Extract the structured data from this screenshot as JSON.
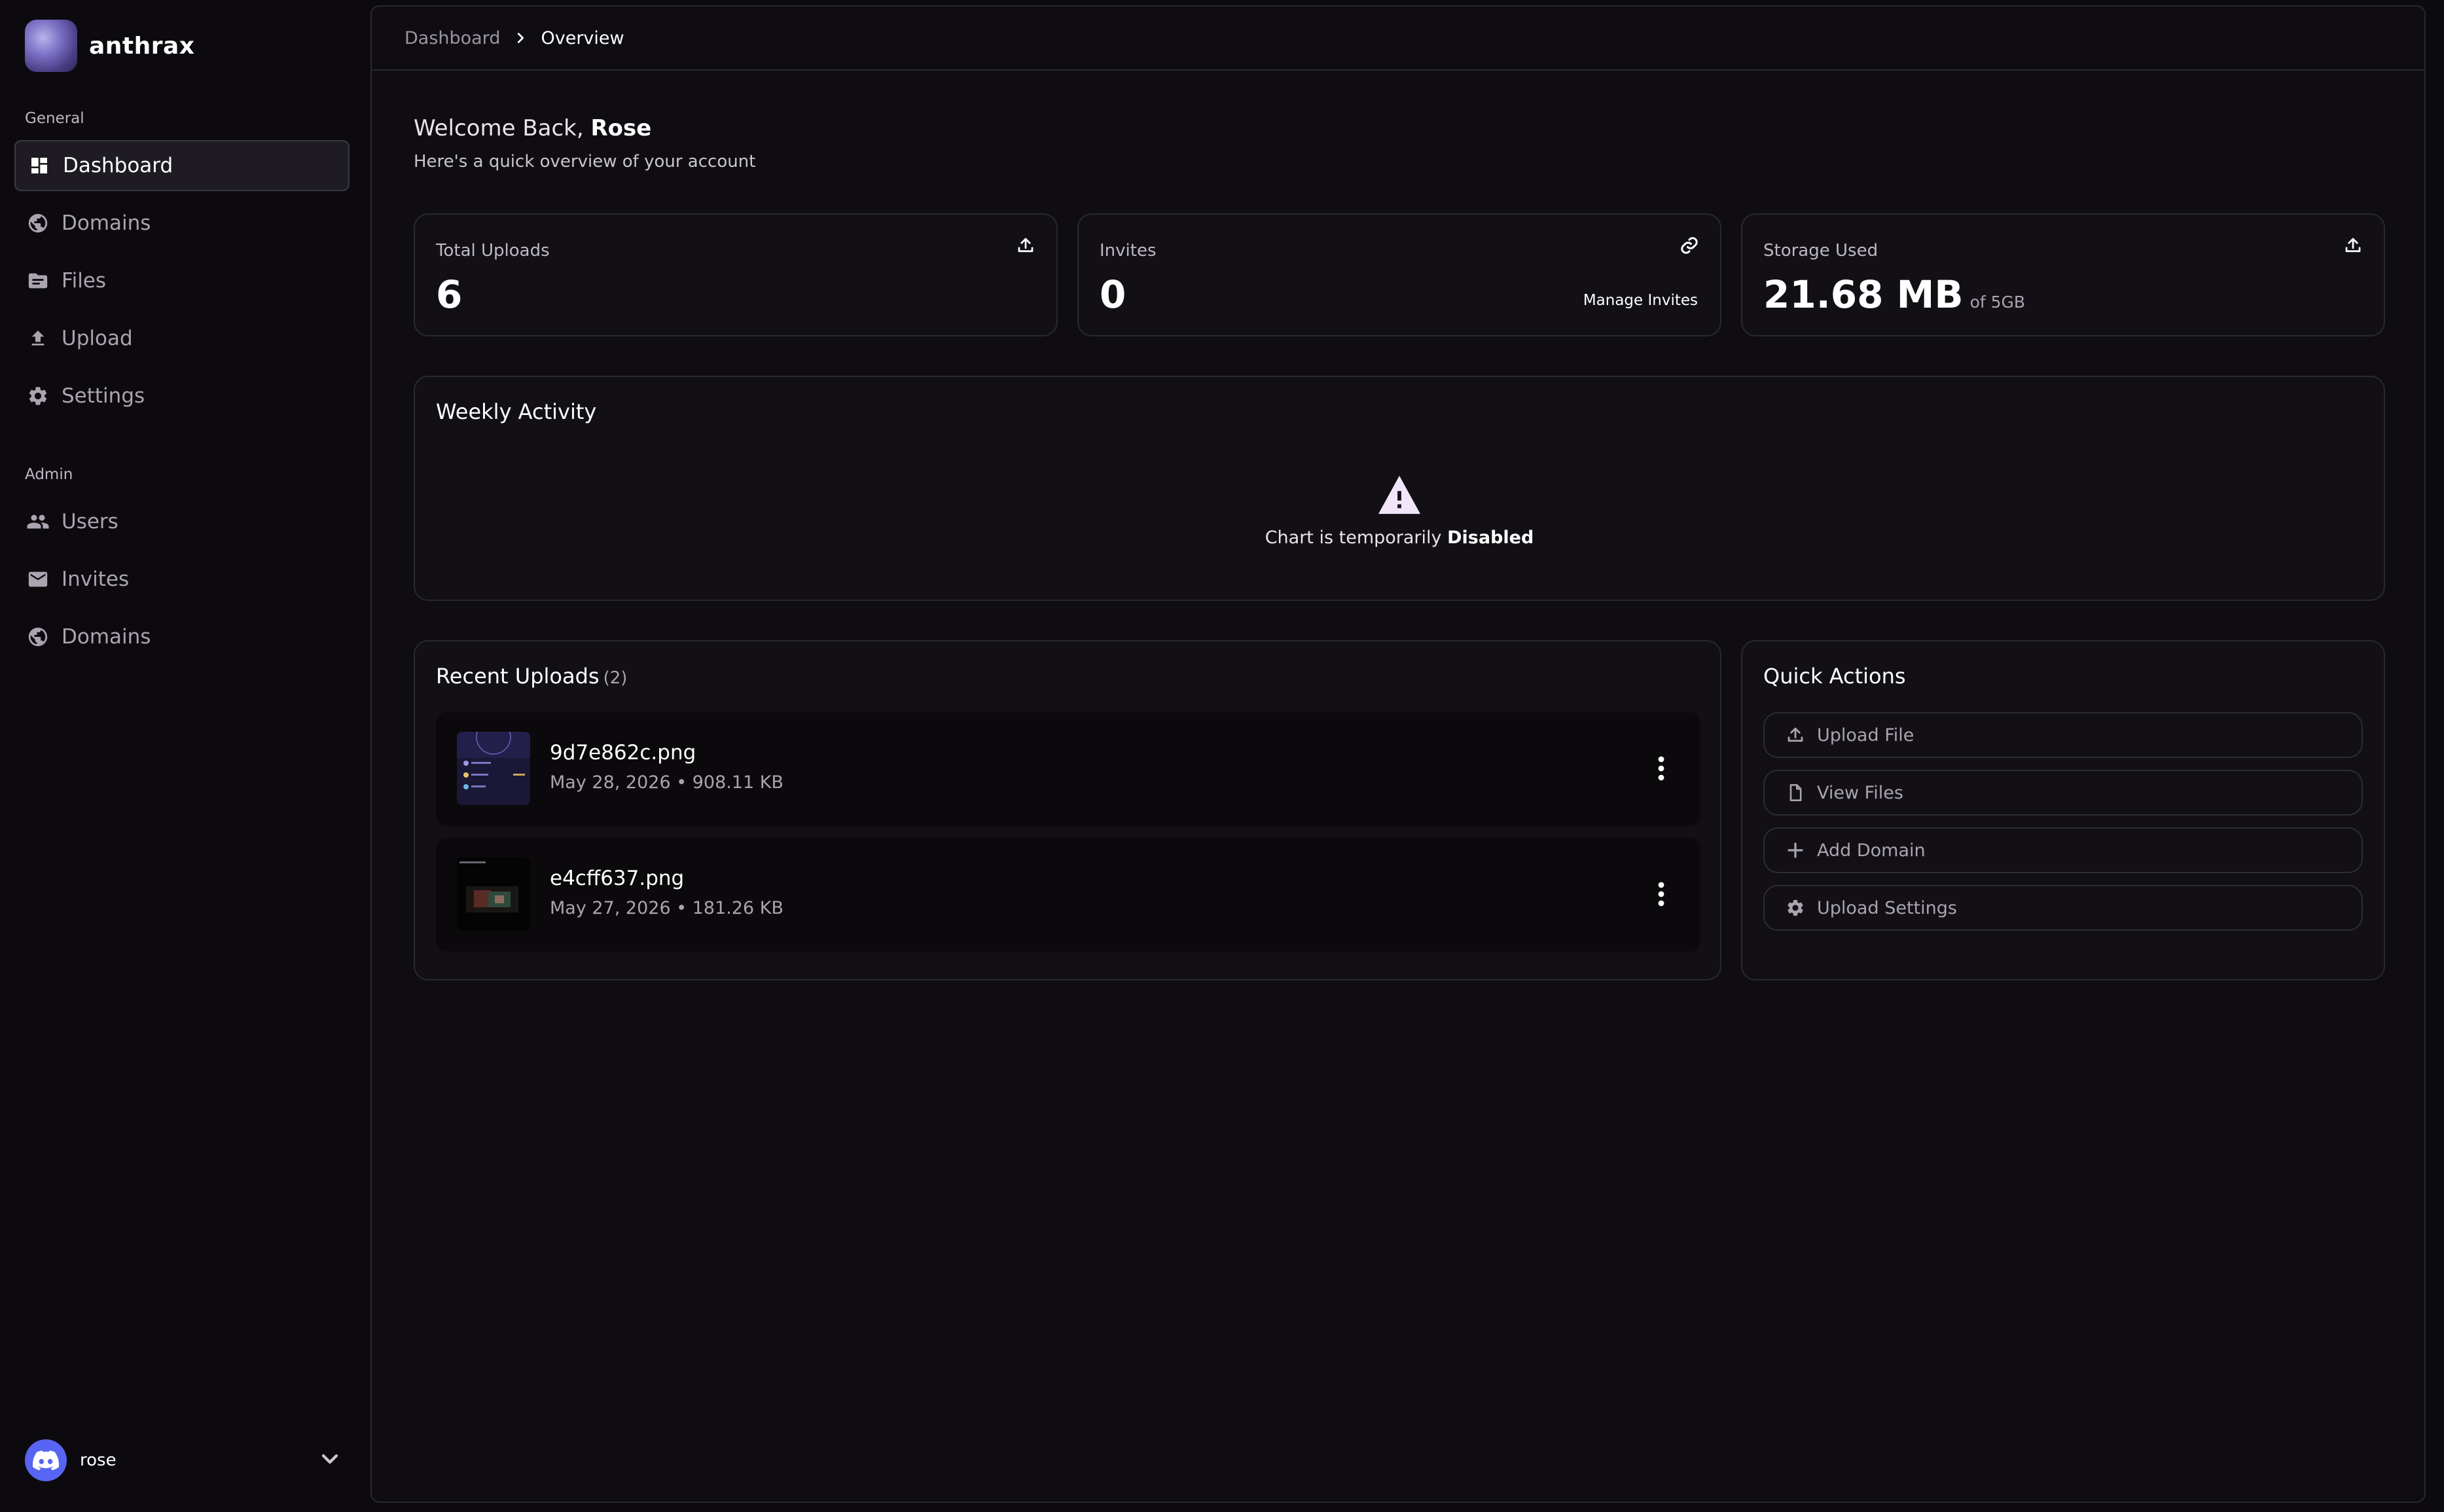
{
  "brand": {
    "name": "anthrax"
  },
  "sidebar": {
    "general_label": "General",
    "admin_label": "Admin",
    "general_items": [
      {
        "label": "Dashboard",
        "icon": "dashboard-icon",
        "active": true
      },
      {
        "label": "Domains",
        "icon": "globe-icon"
      },
      {
        "label": "Files",
        "icon": "folder-icon"
      },
      {
        "label": "Upload",
        "icon": "upload-icon"
      },
      {
        "label": "Settings",
        "icon": "gear-icon"
      }
    ],
    "admin_items": [
      {
        "label": "Users",
        "icon": "users-icon"
      },
      {
        "label": "Invites",
        "icon": "mail-icon"
      },
      {
        "label": "Domains",
        "icon": "globe-icon"
      }
    ],
    "user": {
      "name": "rose",
      "avatar_icon": "discord-icon"
    }
  },
  "breadcrumb": {
    "parent": "Dashboard",
    "current": "Overview"
  },
  "welcome": {
    "greeting": "Welcome Back,",
    "name": "Rose",
    "subtitle": "Here's a quick overview of your account"
  },
  "stats": {
    "uploads": {
      "label": "Total Uploads",
      "value": "6",
      "icon": "upload-icon"
    },
    "invites": {
      "label": "Invites",
      "value": "0",
      "link": "Manage Invites",
      "icon": "link-icon"
    },
    "storage": {
      "label": "Storage Used",
      "value": "21.68 MB",
      "unit": "of 5GB",
      "icon": "upload-icon"
    }
  },
  "weekly": {
    "title": "Weekly Activity",
    "message": "Chart is temporarily",
    "message_bold": "Disabled",
    "icon": "warning-icon"
  },
  "recent": {
    "title": "Recent Uploads",
    "count": "(2)",
    "items": [
      {
        "name": "9d7e862c.png",
        "meta": "May 28, 2026 • 908.11 KB"
      },
      {
        "name": "e4cff637.png",
        "meta": "May 27, 2026 • 181.26 KB"
      }
    ]
  },
  "quick": {
    "title": "Quick Actions",
    "actions": [
      {
        "label": "Upload File",
        "icon": "upload-icon"
      },
      {
        "label": "View Files",
        "icon": "file-icon"
      },
      {
        "label": "Add Domain",
        "icon": "plus-icon"
      },
      {
        "label": "Upload Settings",
        "icon": "gear-icon"
      }
    ]
  },
  "colors": {
    "background": "#0c0a0e",
    "card": "#121015",
    "border": "#2a2830",
    "text": "#ffffff",
    "muted": "#a9a5b0",
    "discord": "#5865f2"
  }
}
